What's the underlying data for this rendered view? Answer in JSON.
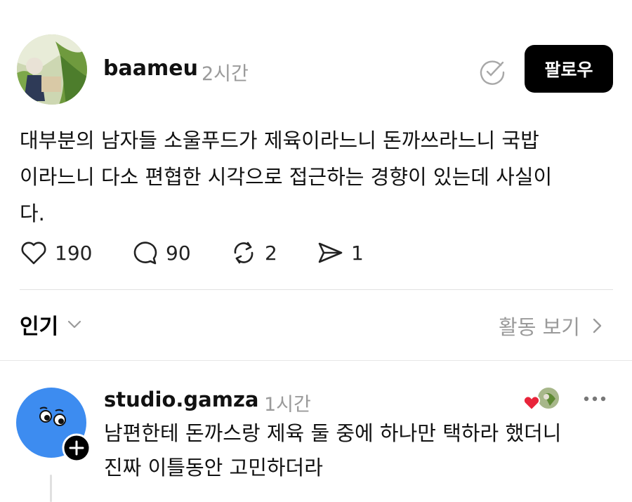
{
  "post": {
    "username": "baameu",
    "time": "2시간",
    "follow_label": "팔로우",
    "text_lines": [
      "대부분의 남자들 소울푸드가 제육이라느니 돈까쓰라느니 국밥",
      "이라느니 다소 편협한 시각으로 접근하는 경향이 있는데 사실이",
      "다."
    ],
    "actions": {
      "likes": "190",
      "replies": "90",
      "reposts": "2",
      "shares": "1"
    }
  },
  "filter": {
    "sort_label": "인기",
    "activity_label": "활동 보기"
  },
  "reply": {
    "username": "studio.gamza",
    "time": "1시간",
    "text_lines": [
      "남편한테 돈까스랑 제육 둘 중에 하나만 택하라 했더니",
      "진짜 이틀동안 고민하더라"
    ]
  },
  "colors": {
    "follow_bg": "#000000",
    "muted": "#9a9a9a",
    "gamza_avatar": "#3d8cf0",
    "heart": "#e8243a"
  }
}
